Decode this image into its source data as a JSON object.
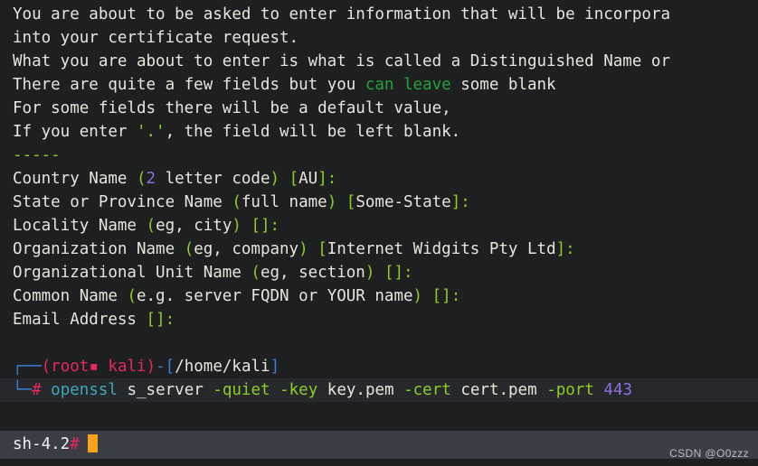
{
  "terminal": {
    "theme": {
      "background": "#1d1f21",
      "foreground": "#e6e6dc",
      "command_line_background": "#26282c",
      "shell_row_background": "#3a3d45",
      "green_punctuation": "#8ece24",
      "highlight_green": "#23a33a",
      "purple": "#8f6fe0",
      "kali_pink": "#e8285d",
      "kali_blue": "#3a7fd5",
      "teal": "#3fa8b8",
      "cursor": "#f7a419"
    },
    "intro": {
      "l1": "You are about to be asked to enter information that will be incorpora",
      "l2": "into your certificate request.",
      "l3": "What you are about to enter is what is called a Distinguished Name or",
      "l4_a": "There are quite a few fields but ",
      "l4_b": "can leave",
      "l4_c": " some blank",
      "l4_you": "you ",
      "l5": "For some fields there will be a default value,",
      "l6_a": "If you enter ",
      "l6_b": "'.'",
      "l6_c": ", the field will be left blank.",
      "separator": "-----"
    },
    "fields": [
      {
        "label": "Country Name ",
        "open_paren": "(",
        "hint_num": "2",
        "hint_rest": " letter code",
        "close_paren": ")",
        "space": " ",
        "open_bracket": "[",
        "default": "AU",
        "close_bracket": "]",
        "colon": ":"
      },
      {
        "label": "State or Province Name ",
        "open_paren": "(",
        "hint_num": "",
        "hint_rest": "full name",
        "close_paren": ")",
        "space": " ",
        "open_bracket": "[",
        "default": "Some-State",
        "close_bracket": "]",
        "colon": ":"
      },
      {
        "label": "Locality Name ",
        "open_paren": "(",
        "hint_num": "",
        "hint_rest": "eg, city",
        "close_paren": ")",
        "space": " ",
        "open_bracket": "[",
        "default": "",
        "close_bracket": "]",
        "colon": ":"
      },
      {
        "label": "Organization Name ",
        "open_paren": "(",
        "hint_num": "",
        "hint_rest": "eg, company",
        "close_paren": ")",
        "space": " ",
        "open_bracket": "[",
        "default": "Internet Widgits Pty Ltd",
        "close_bracket": "]",
        "colon": ":"
      },
      {
        "label": "Organizational Unit Name ",
        "open_paren": "(",
        "hint_num": "",
        "hint_rest": "eg, section",
        "close_paren": ")",
        "space": " ",
        "open_bracket": "[",
        "default": "",
        "close_bracket": "]",
        "colon": ":"
      },
      {
        "label": "Common Name ",
        "open_paren": "(",
        "hint_num": "",
        "hint_rest": "e.g. server FQDN or YOUR name",
        "close_paren": ")",
        "space": " ",
        "open_bracket": "[",
        "default": "",
        "close_bracket": "]",
        "colon": ":"
      },
      {
        "label": "Email Address ",
        "open_paren": "",
        "hint_num": "",
        "hint_rest": "",
        "close_paren": "",
        "space": "",
        "open_bracket": "[",
        "default": "",
        "close_bracket": "]",
        "colon": ":"
      }
    ],
    "prompt": {
      "box_top": "┌──",
      "box_bottom": "└─",
      "paren_open": "(",
      "user": "root",
      "user_block": "▪",
      "host_sep": " ",
      "host": "kali",
      "paren_close": ")",
      "dash": "-",
      "bracket_open": "[",
      "path": "/home/kali",
      "bracket_close": "]",
      "hash": "#",
      "command_name": "openssl",
      "subcommand": "s_server",
      "flag_quiet": "-quiet",
      "flag_key": "-key",
      "value_key": "key.pem",
      "flag_cert": "-cert",
      "value_cert": "cert.pem",
      "flag_port": "-port",
      "value_port": "443"
    },
    "shell": {
      "prompt_text": "sh-4.2",
      "prompt_hash": "#"
    },
    "watermark": "CSDN @O0zzz"
  }
}
